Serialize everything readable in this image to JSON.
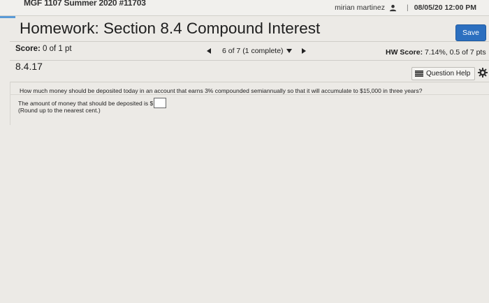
{
  "topbar": {
    "course": "MGF 1107 Summer 2020 #11703",
    "user_name": "mirian martinez",
    "separator": "|",
    "due_date": "08/05/20 12:00 PM"
  },
  "homework": {
    "title": "Homework: Section 8.4 Compound Interest",
    "save_label": "Save"
  },
  "score": {
    "label": "Score:",
    "value": "0 of 1 pt"
  },
  "navigation": {
    "position": "6 of 7 (1 complete)"
  },
  "hw_score": {
    "label": "HW Score:",
    "value": "7.14%, 0.5 of 7 pts"
  },
  "question": {
    "number": "8.4.17",
    "help_label": "Question Help",
    "text": "How much money should be deposited today in an account that earns 3% compounded semiannually so that it will accumulate to $15,000 in three years?",
    "answer_prefix": "The amount of money that should be deposited is $",
    "answer_value": "",
    "rounding_note": "(Round up to the nearest cent.)"
  },
  "icons": {
    "user": "person-icon",
    "prev": "arrow-left-icon",
    "next": "arrow-right-icon",
    "dropdown": "caret-down-icon",
    "help": "list-icon",
    "settings": "gear-icon"
  },
  "colors": {
    "save_button": "#2c6fbf",
    "accent": "#5a9ad6"
  }
}
